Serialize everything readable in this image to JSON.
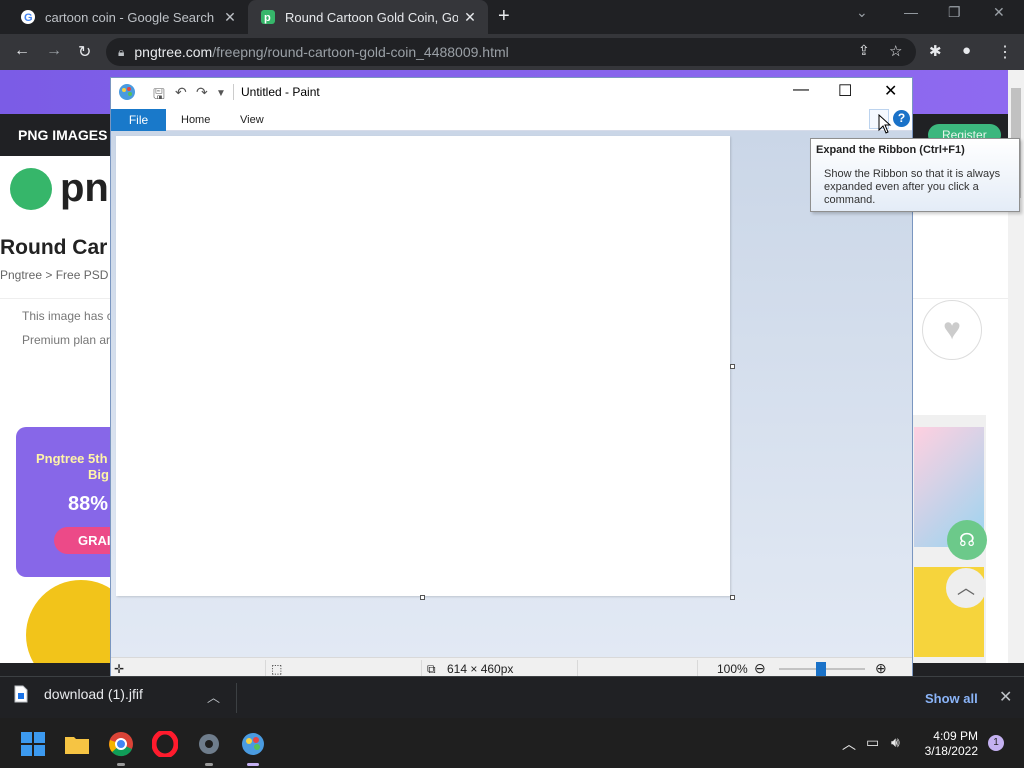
{
  "browser": {
    "tabs": [
      {
        "title": "cartoon coin - Google Search",
        "favicon": "google-icon"
      },
      {
        "title": "Round Cartoon Gold Coin, Gold Coin",
        "favicon": "pngtree-icon"
      }
    ],
    "url_host": "pngtree.com",
    "url_path": "/freepng/round-cartoon-gold-coin_4488009.html"
  },
  "page": {
    "nav_label": "PNG IMAGES",
    "register_label": "Register",
    "logo_text": "pn",
    "title": "Round Car",
    "breadcrumb": "Pngtree > Free PSD",
    "notice_line1": "This image has c",
    "notice_line2": "Premium plan ar",
    "promo_line1": "Pngtree 5th",
    "promo_line2": "Big",
    "promo_discount": "88%",
    "promo_button": "GRAI"
  },
  "paint": {
    "title": "Untitled - Paint",
    "tabs": {
      "file": "File",
      "home": "Home",
      "view": "View"
    },
    "status": {
      "size": "614 × 460px",
      "zoom": "100%"
    },
    "zoom_percent": 100,
    "tooltip": {
      "title": "Expand the Ribbon (Ctrl+F1)",
      "body": "Show the Ribbon so that it is always expanded even after you click a command."
    }
  },
  "download_bar": {
    "file_name": "download (1).jfif",
    "show_all": "Show all"
  },
  "taskbar": {
    "time": "4:09 PM",
    "date": "3/18/2022",
    "notification_count": "1"
  },
  "colors": {
    "paint_file_tab": "#1979ca",
    "chrome_dark": "#202124",
    "pngtree_purple": "#8767e8",
    "pngtree_green": "#36b66a"
  }
}
